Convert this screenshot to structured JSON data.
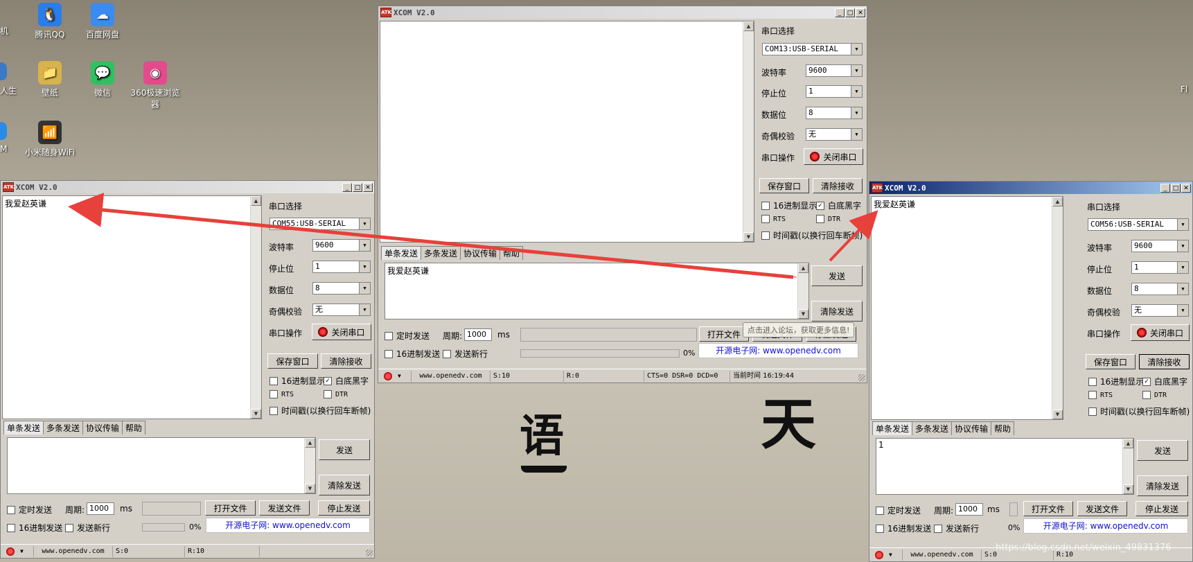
{
  "desktop": {
    "icons": [
      {
        "label": "腾讯QQ",
        "glyph": "🐧",
        "color": "#2b7de9"
      },
      {
        "label": "百度网盘",
        "glyph": "☁",
        "color": "#3a8bf2"
      },
      {
        "label": "壁纸",
        "glyph": "📁",
        "color": "#d8b24a"
      },
      {
        "label": "微信",
        "glyph": "💬",
        "color": "#2ec162"
      },
      {
        "label": "360极速浏览器",
        "glyph": "◉",
        "color": "#e44a8c"
      },
      {
        "label": "小米随身WiFi",
        "glyph": "📶",
        "color": "#333333"
      }
    ],
    "edge_labels": [
      "机",
      "人生",
      "M",
      "Fl"
    ],
    "calligraphy": [
      "语",
      "天"
    ]
  },
  "windows": {
    "left": {
      "title": "XCOM V2.0",
      "receive_text": "我爱赵英谦",
      "port_select_label": "串口选择",
      "port": "COM55:USB-SERIAL",
      "baud_label": "波特率",
      "baud": "9600",
      "stop_label": "停止位",
      "stop": "1",
      "data_label": "数据位",
      "data": "8",
      "parity_label": "奇偶校验",
      "parity": "无",
      "op_label": "串口操作",
      "op_button": "关闭串口",
      "save_window": "保存窗口",
      "clear_receive": "清除接收",
      "hex_display": "16进制显示",
      "white_bg": "白底黑字",
      "rts": "RTS",
      "dtr": "DTR",
      "timestamp": "时间戳(以换行回车断帧)",
      "tabs": [
        "单条发送",
        "多条发送",
        "协议传输",
        "帮助"
      ],
      "send_text": "",
      "send": "发送",
      "clear_send": "清除发送",
      "timed_send": "定时发送",
      "period_label": "周期:",
      "period": "1000",
      "ms": "ms",
      "open_file": "打开文件",
      "send_file": "发送文件",
      "stop_send": "停止发送",
      "hex_send": "16进制发送",
      "send_newline": "发送新行",
      "progress": "0%",
      "link": "开源电子网: www.openedv.com",
      "status_site": "www.openedv.com",
      "status_s": "S:0",
      "status_r": "R:10"
    },
    "middle": {
      "title": "XCOM V2.0",
      "receive_text": "",
      "port_select_label": "串口选择",
      "port": "COM13:USB-SERIAL",
      "baud_label": "波特率",
      "baud": "9600",
      "stop_label": "停止位",
      "stop": "1",
      "data_label": "数据位",
      "data": "8",
      "parity_label": "奇偶校验",
      "parity": "无",
      "op_label": "串口操作",
      "op_button": "关闭串口",
      "save_window": "保存窗口",
      "clear_receive": "清除接收",
      "hex_display": "16进制显示",
      "white_bg": "白底黑字",
      "rts": "RTS",
      "dtr": "DTR",
      "timestamp": "时间戳(以换行回车断帧)",
      "tabs": [
        "单条发送",
        "多条发送",
        "协议传输",
        "帮助"
      ],
      "send_text": "我爱赵英谦",
      "send": "发送",
      "clear_send": "清除发送",
      "timed_send": "定时发送",
      "period_label": "周期:",
      "period": "1000",
      "ms": "ms",
      "open_file": "打开文件",
      "send_file": "发送文件",
      "stop_send": "停止发送",
      "hex_send": "16进制发送",
      "send_newline": "发送新行",
      "progress": "0%",
      "link": "开源电子网: www.openedv.com",
      "tooltip": "点击进入论坛，获取更多信息!",
      "status_site": "www.openedv.com",
      "status_s": "S:10",
      "status_r": "R:0",
      "status_lines": "CTS=0 DSR=0 DCD=0",
      "status_time": "当前时间 16:19:44"
    },
    "right": {
      "title": "XCOM V2.0",
      "receive_text": "我爱赵英谦",
      "port_select_label": "串口选择",
      "port": "COM56:USB-SERIAL",
      "baud_label": "波特率",
      "baud": "9600",
      "stop_label": "停止位",
      "stop": "1",
      "data_label": "数据位",
      "data": "8",
      "parity_label": "奇偶校验",
      "parity": "无",
      "op_label": "串口操作",
      "op_button": "关闭串口",
      "save_window": "保存窗口",
      "clear_receive": "清除接收",
      "hex_display": "16进制显示",
      "white_bg": "白底黑字",
      "rts": "RTS",
      "dtr": "DTR",
      "timestamp": "时间戳(以换行回车断帧)",
      "tabs": [
        "单条发送",
        "多条发送",
        "协议传输",
        "帮助"
      ],
      "send_text": "1",
      "send": "发送",
      "clear_send": "清除发送",
      "timed_send": "定时发送",
      "period_label": "周期:",
      "period": "1000",
      "ms": "ms",
      "open_file": "打开文件",
      "send_file": "发送文件",
      "stop_send": "停止发送",
      "hex_send": "16进制发送",
      "send_newline": "发送新行",
      "progress": "0%",
      "link": "开源电子网: www.openedv.com",
      "status_site": "www.openedv.com",
      "status_s": "S:0",
      "status_r": "R:10"
    }
  },
  "watermark": "https://blog.csdn.net/weixin_49831376",
  "colors": {
    "annotation": "#e8403a",
    "link": "#1010d0"
  }
}
